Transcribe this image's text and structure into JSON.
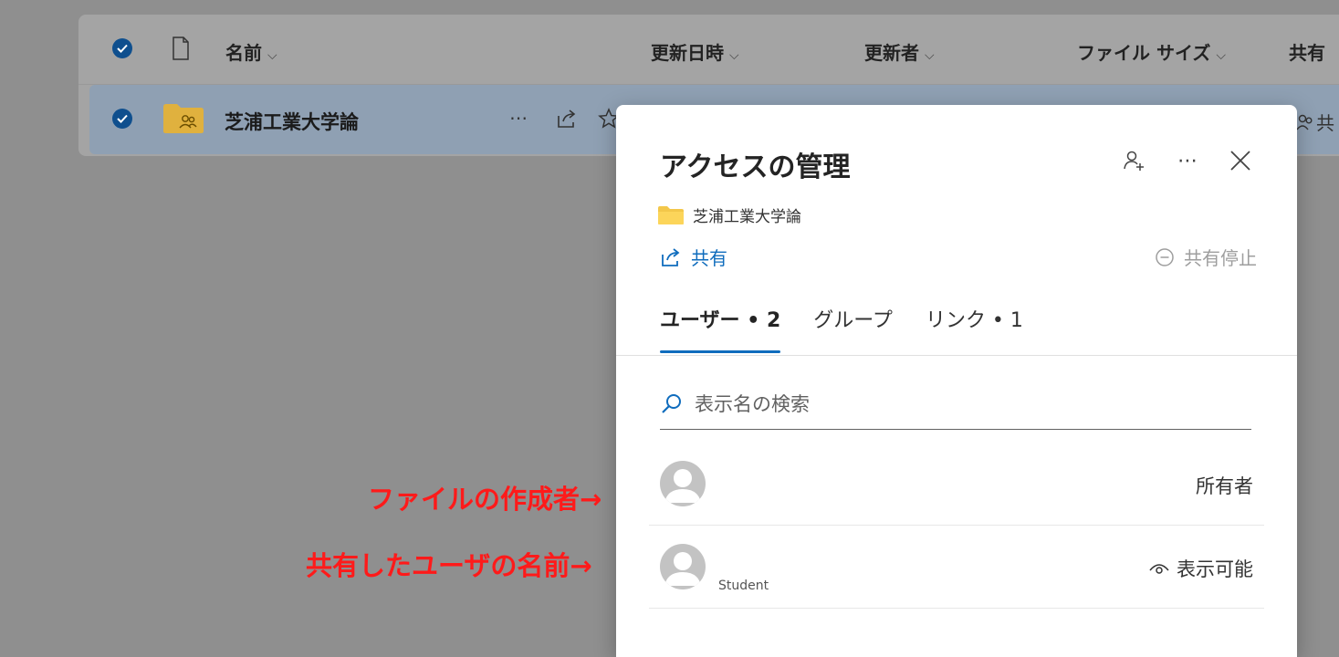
{
  "file_list": {
    "columns": {
      "name": "名前",
      "modified": "更新日時",
      "modified_by": "更新者",
      "file_size": "ファイル サイズ",
      "sharing": "共有"
    },
    "row": {
      "name": "芝浦工業大学論",
      "sharing_partial": "共"
    }
  },
  "dialog": {
    "title": "アクセスの管理",
    "file_name": "芝浦工業大学論",
    "share_label": "共有",
    "stop_share_label": "共有停止",
    "tabs": [
      {
        "label": "ユーザー • 2",
        "active": true
      },
      {
        "label": "グループ",
        "active": false
      },
      {
        "label": "リンク • 1",
        "active": false
      }
    ],
    "search": {
      "placeholder": "表示名の検索"
    },
    "users": [
      {
        "subtitle": "",
        "role": "所有者"
      },
      {
        "subtitle": "Student",
        "role": "表示可能"
      }
    ]
  },
  "annotations": {
    "creator": "ファイルの作成者→",
    "shared_user": "共有したユーザの名前→"
  },
  "colors": {
    "accent": "#0f6cbd",
    "annotation": "#ff1a1a",
    "folder": "#f3c74a"
  }
}
